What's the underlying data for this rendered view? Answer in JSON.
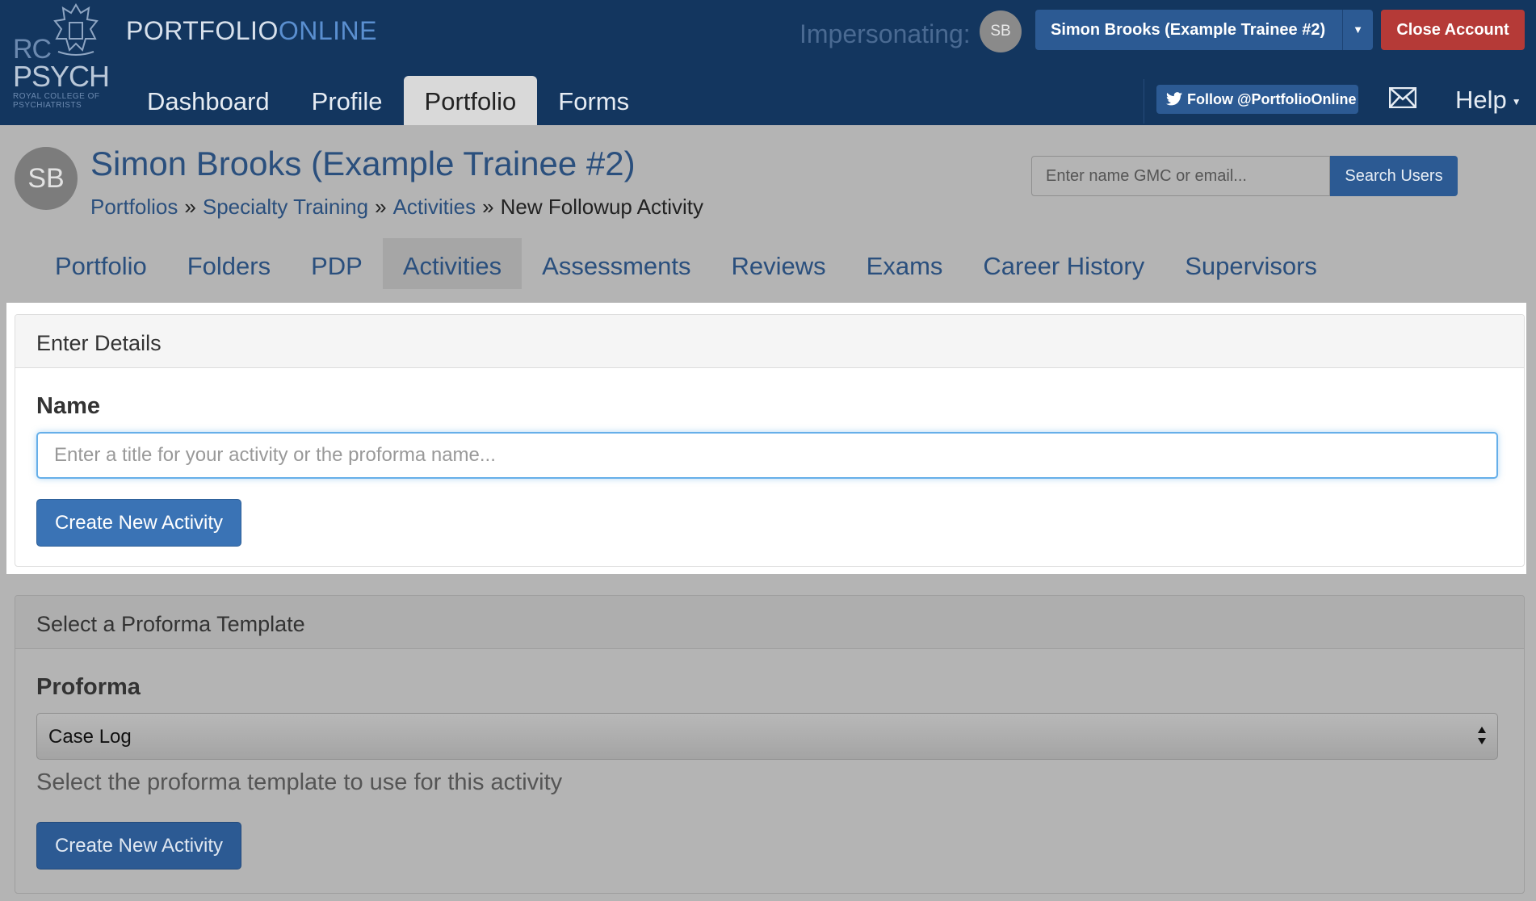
{
  "logo": {
    "line1": "RC",
    "line2": "PSYCH",
    "line3": "ROYAL COLLEGE OF",
    "line4": "PSYCHIATRISTS"
  },
  "brand": {
    "part1": "PORTFOLIO",
    "part2": "ONLINE"
  },
  "main_nav": [
    {
      "label": "Dashboard",
      "active": false
    },
    {
      "label": "Profile",
      "active": false
    },
    {
      "label": "Portfolio",
      "active": true
    },
    {
      "label": "Forms",
      "active": false
    }
  ],
  "topbar": {
    "impersonating_label": "Impersonating:",
    "avatar_initials": "SB",
    "user_button": "Simon Brooks (Example Trainee #2)",
    "close_account": "Close Account",
    "follow_button": "Follow @PortfolioOnline",
    "help": "Help",
    "icons": {
      "twitter": "twitter-icon",
      "mail": "mail-icon",
      "dropdown": "caret-down-icon"
    }
  },
  "header": {
    "avatar_initials": "SB",
    "title": "Simon Brooks (Example Trainee #2)",
    "breadcrumb": [
      {
        "label": "Portfolios",
        "link": true
      },
      {
        "label": "Specialty Training",
        "link": true
      },
      {
        "label": "Activities",
        "link": true
      },
      {
        "label": "New Followup Activity",
        "link": false
      }
    ],
    "breadcrumb_separator": "»",
    "search_placeholder": "Enter name GMC or email...",
    "search_button": "Search Users"
  },
  "sub_nav": [
    {
      "label": "Portfolio",
      "active": false
    },
    {
      "label": "Folders",
      "active": false
    },
    {
      "label": "PDP",
      "active": false
    },
    {
      "label": "Activities",
      "active": true
    },
    {
      "label": "Assessments",
      "active": false
    },
    {
      "label": "Reviews",
      "active": false
    },
    {
      "label": "Exams",
      "active": false
    },
    {
      "label": "Career History",
      "active": false
    },
    {
      "label": "Supervisors",
      "active": false
    }
  ],
  "enter_details": {
    "heading": "Enter Details",
    "name_label": "Name",
    "name_value": "",
    "name_placeholder": "Enter a title for your activity or the proforma name...",
    "submit": "Create New Activity"
  },
  "proforma_section": {
    "heading": "Select a Proforma Template",
    "proforma_label": "Proforma",
    "selected": "Case Log",
    "help_text": "Select the proforma template to use for this activity",
    "submit": "Create New Activity"
  },
  "colors": {
    "navbar": "#13365f",
    "primary": "#3a73b5",
    "danger": "#b53a37",
    "overlay": "#b4b4b4"
  }
}
